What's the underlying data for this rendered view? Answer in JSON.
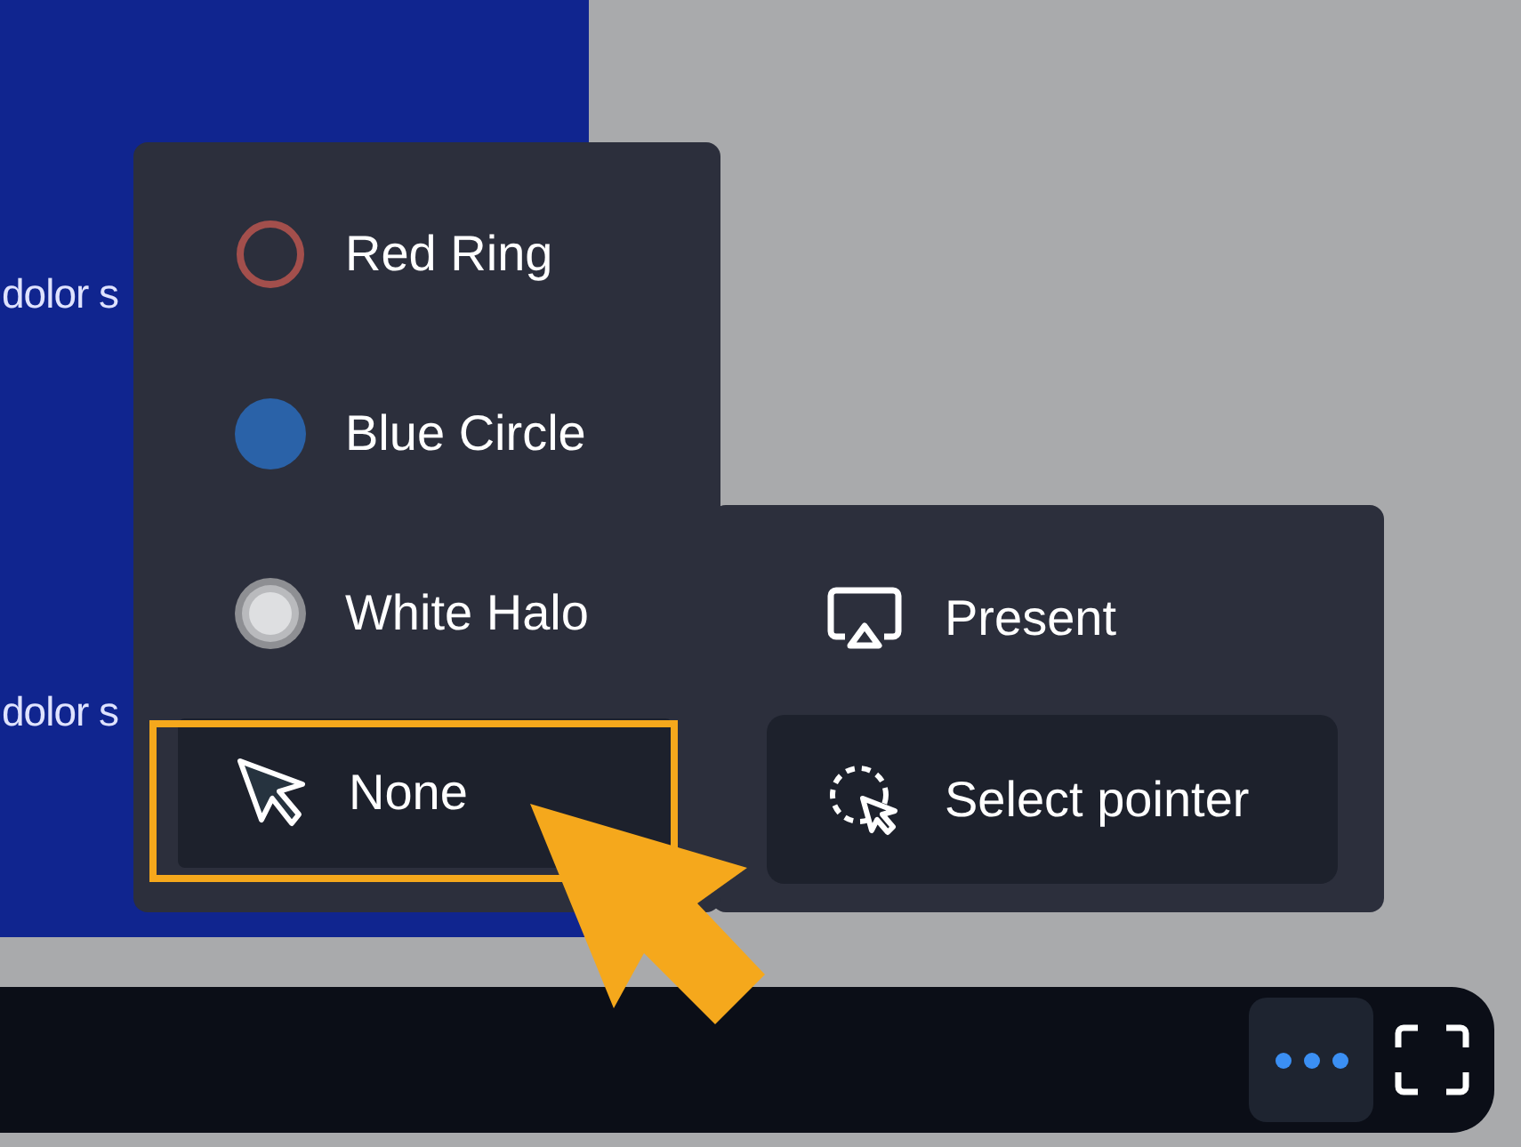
{
  "slide": {
    "lines": [
      "dolor s",
      "dolor s"
    ]
  },
  "pointer_menu": {
    "items": [
      {
        "kind": "ring",
        "label": "Red Ring",
        "selected": false
      },
      {
        "kind": "circle",
        "label": "Blue Circle",
        "selected": false
      },
      {
        "kind": "halo",
        "label": "White Halo",
        "selected": false
      },
      {
        "kind": "none",
        "label": "None",
        "selected": true
      }
    ]
  },
  "more_menu": {
    "items": [
      {
        "kind": "present",
        "label": "Present",
        "selected": false
      },
      {
        "kind": "pointer",
        "label": "Select pointer",
        "selected": true
      }
    ]
  },
  "toolbar": {
    "more_selected": true
  }
}
